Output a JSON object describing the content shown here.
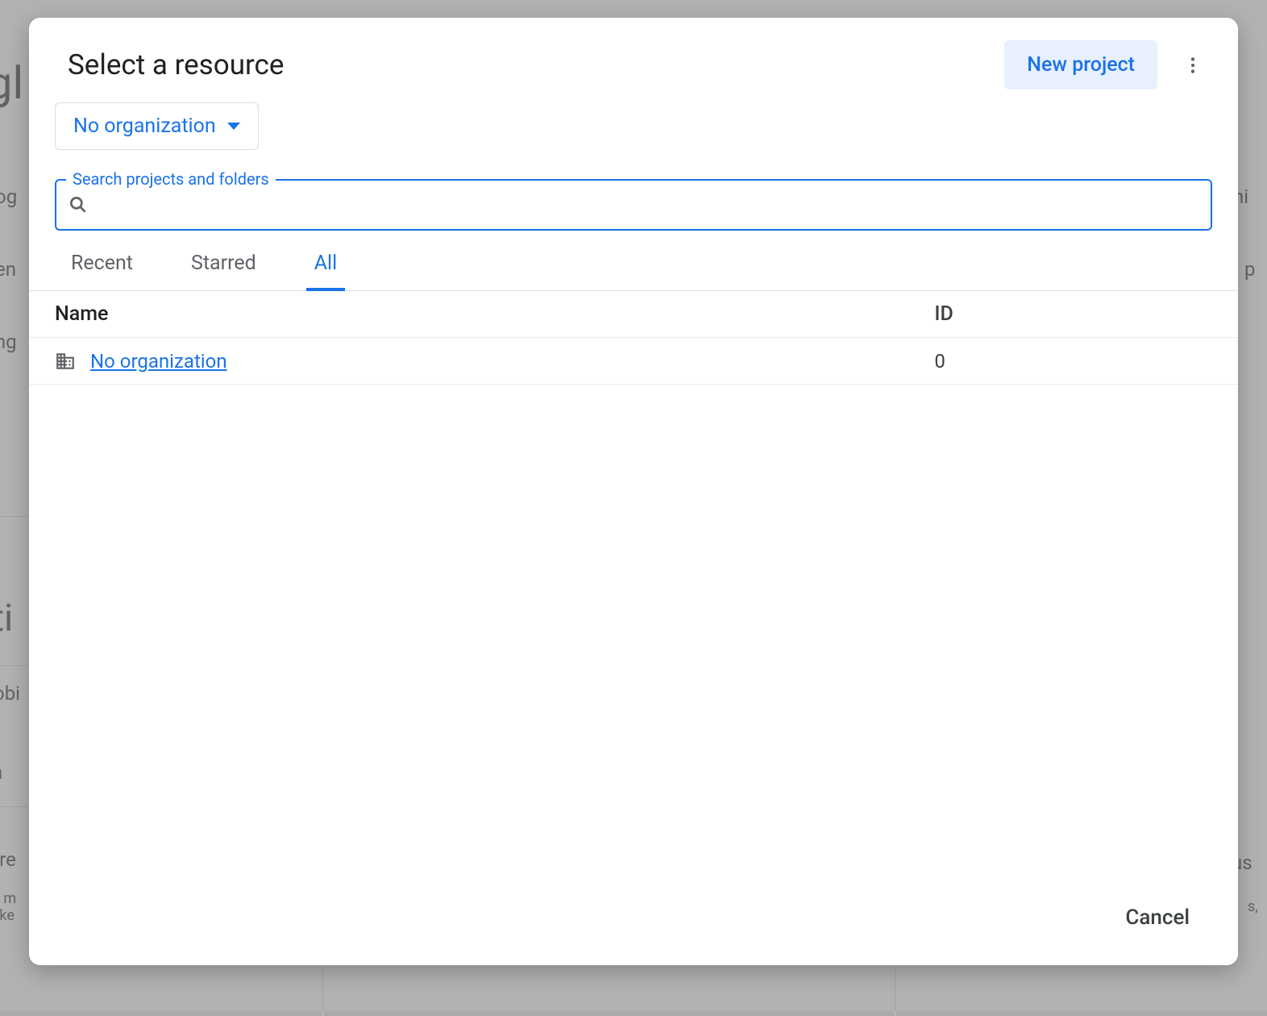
{
  "dialog": {
    "title": "Select a resource",
    "new_project_label": "New project",
    "org_selector_label": "No organization",
    "search_label": "Search projects and folders",
    "search_value": "",
    "tabs": [
      {
        "label": "Recent",
        "active": false
      },
      {
        "label": "Starred",
        "active": false
      },
      {
        "label": "All",
        "active": true
      }
    ],
    "table": {
      "columns": {
        "name": "Name",
        "id": "ID"
      },
      "rows": [
        {
          "icon": "domain",
          "name": "No organization",
          "id": "0"
        }
      ]
    },
    "cancel_label": "Cancel"
  }
}
